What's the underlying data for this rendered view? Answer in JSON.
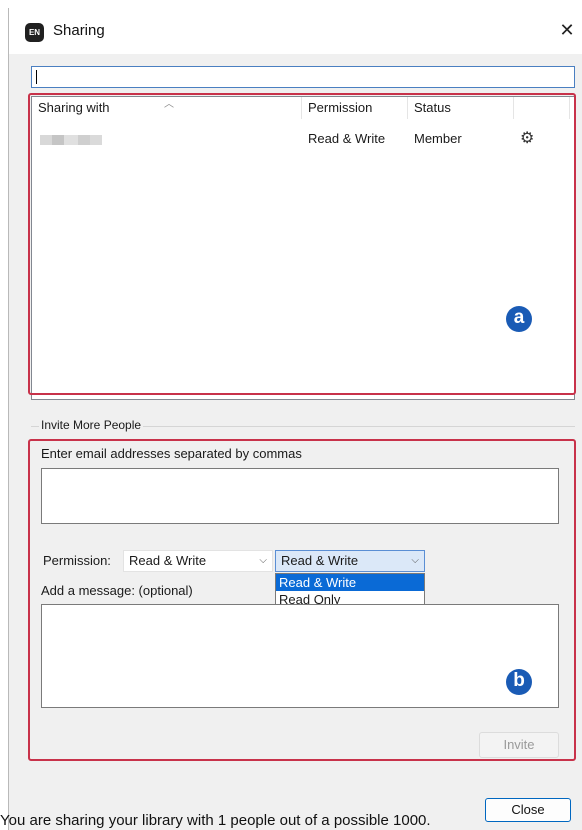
{
  "window": {
    "app_badge": "EN",
    "title": "Sharing",
    "close_glyph": "✕"
  },
  "search": {
    "value": ""
  },
  "sharing_list": {
    "columns": [
      "Sharing with",
      "Permission",
      "Status",
      ""
    ],
    "rows": [
      {
        "sharing_with": "",
        "permission": "Read & Write",
        "status": "Member",
        "action_icon": "gear-icon"
      }
    ]
  },
  "annotations": {
    "a": "a",
    "b": "b",
    "color": "#c8324a",
    "badge_color": "#1a5bb5"
  },
  "invite": {
    "group_title": "Invite More People",
    "email_label": "Enter email addresses separated by commas",
    "email_value": "",
    "permission_label": "Permission:",
    "permission_value": "Read & Write",
    "permission_value_open": "Read & Write",
    "permission_options": [
      "Read & Write",
      "Read Only"
    ],
    "selected_option": "Read & Write",
    "message_label": "Add a message: (optional)",
    "message_value": "",
    "invite_button": "Invite"
  },
  "footer": {
    "close_button": "Close",
    "status_text": "You are sharing your library with 1 people out of a possible 1000."
  }
}
